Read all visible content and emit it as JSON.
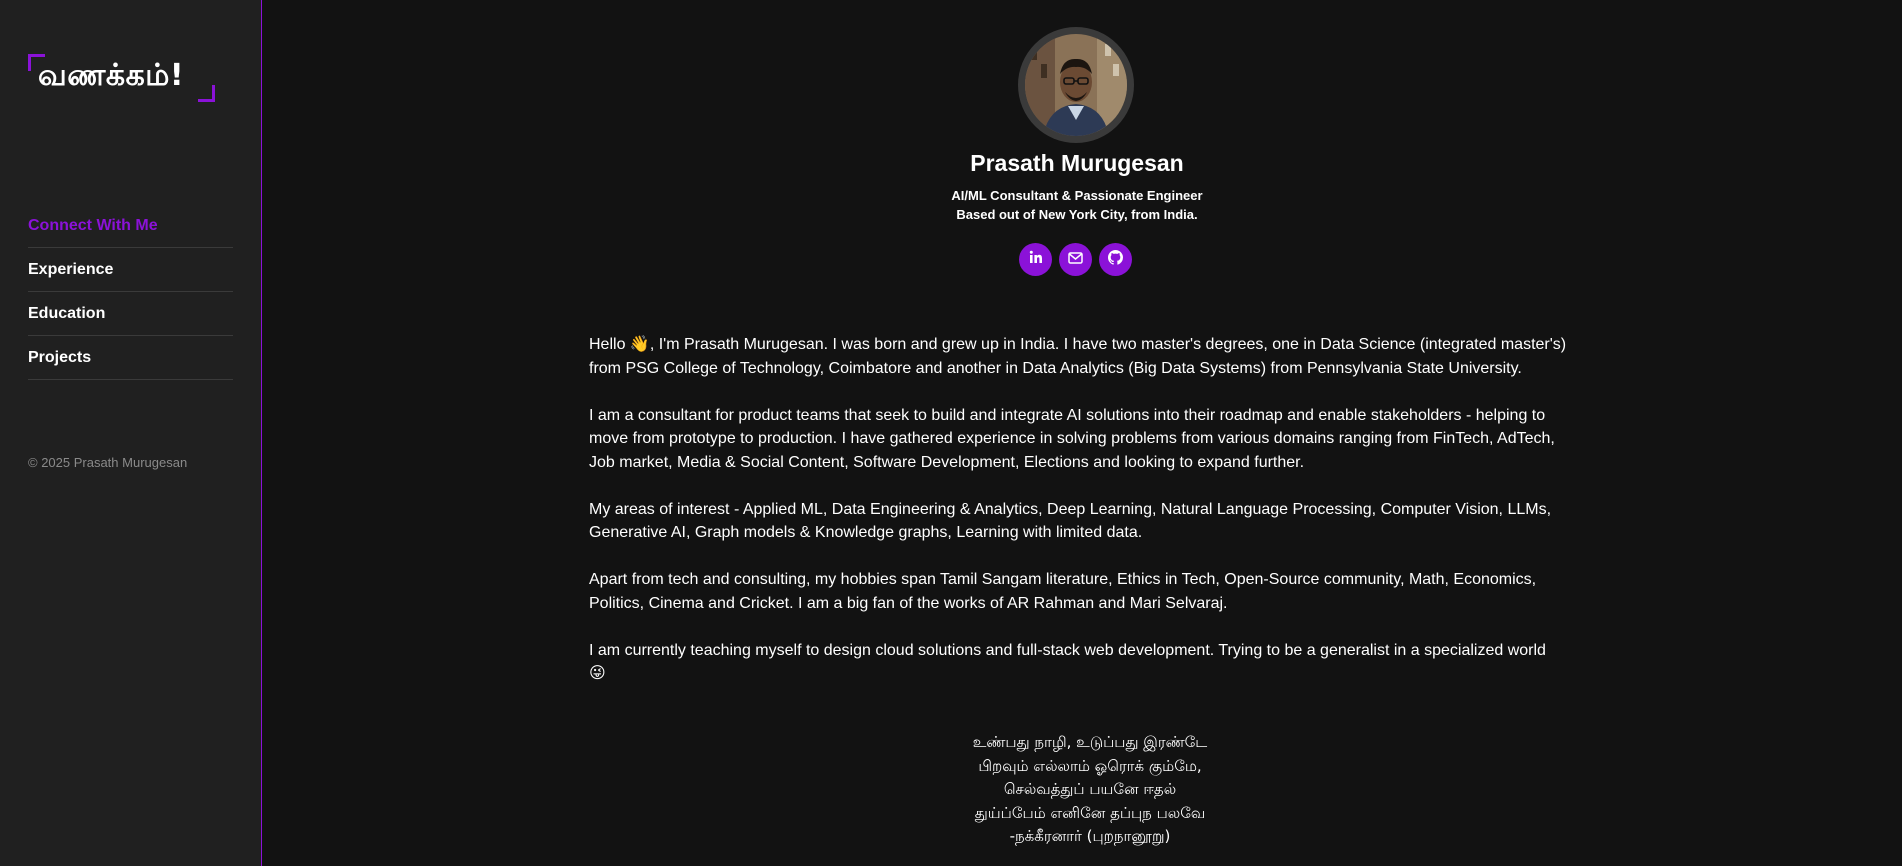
{
  "sidebar": {
    "logo_text": "வணக்கம்!",
    "nav": [
      {
        "label": "Connect With Me",
        "active": true
      },
      {
        "label": "Experience",
        "active": false
      },
      {
        "label": "Education",
        "active": false
      },
      {
        "label": "Projects",
        "active": false
      }
    ],
    "copyright": "© 2025 Prasath Murugesan"
  },
  "profile": {
    "name": "Prasath Murugesan",
    "tagline_1": "AI/ML Consultant & Passionate Engineer",
    "tagline_2": "Based out of New York City, from India.",
    "socials": [
      {
        "icon": "linkedin-icon"
      },
      {
        "icon": "mail-icon"
      },
      {
        "icon": "github-icon"
      }
    ]
  },
  "about": {
    "p1": "Hello 👋, I'm Prasath Murugesan. I was born and grew up in India. I have two master's degrees, one in Data Science (integrated master's) from PSG College of Technology, Coimbatore and another in Data Analytics (Big Data Systems) from Pennsylvania State University.",
    "p2": "I am a consultant for product teams that seek to build and integrate AI solutions into their roadmap and enable stakeholders - helping to move from prototype to production. I have gathered experience in solving problems from various domains ranging from FinTech, AdTech, Job market, Media & Social Content, Software Development, Elections and looking to expand further.",
    "p3": "My areas of interest - Applied ML, Data Engineering & Analytics, Deep Learning, Natural Language Processing, Computer Vision, LLMs, Generative AI, Graph models & Knowledge graphs, Learning with limited data.",
    "p4": "Apart from tech and consulting, my hobbies span Tamil Sangam literature, Ethics in Tech, Open-Source community, Math, Economics, Politics, Cinema and Cricket. I am a big fan of the works of AR Rahman and Mari Selvaraj.",
    "p5": "I am currently teaching myself to design cloud solutions and full-stack web development. Trying to be a generalist in a specialized world 😜"
  },
  "poem": {
    "line1": "உண்பது நாழி, உடுப்பது இரண்டே",
    "line2": "பிறவும் எல்லாம் ஓரொக் கும்மே,",
    "line3": "செல்வத்துப் பயனே ஈதல்",
    "line4": "துய்ப்பேம் எனினே தப்புந பலவே",
    "line5": "-நக்கீரனார் (புறநானூறு)"
  },
  "colors": {
    "accent": "#8b12d8",
    "sidebar_bg": "#202020",
    "main_bg": "#121212"
  }
}
